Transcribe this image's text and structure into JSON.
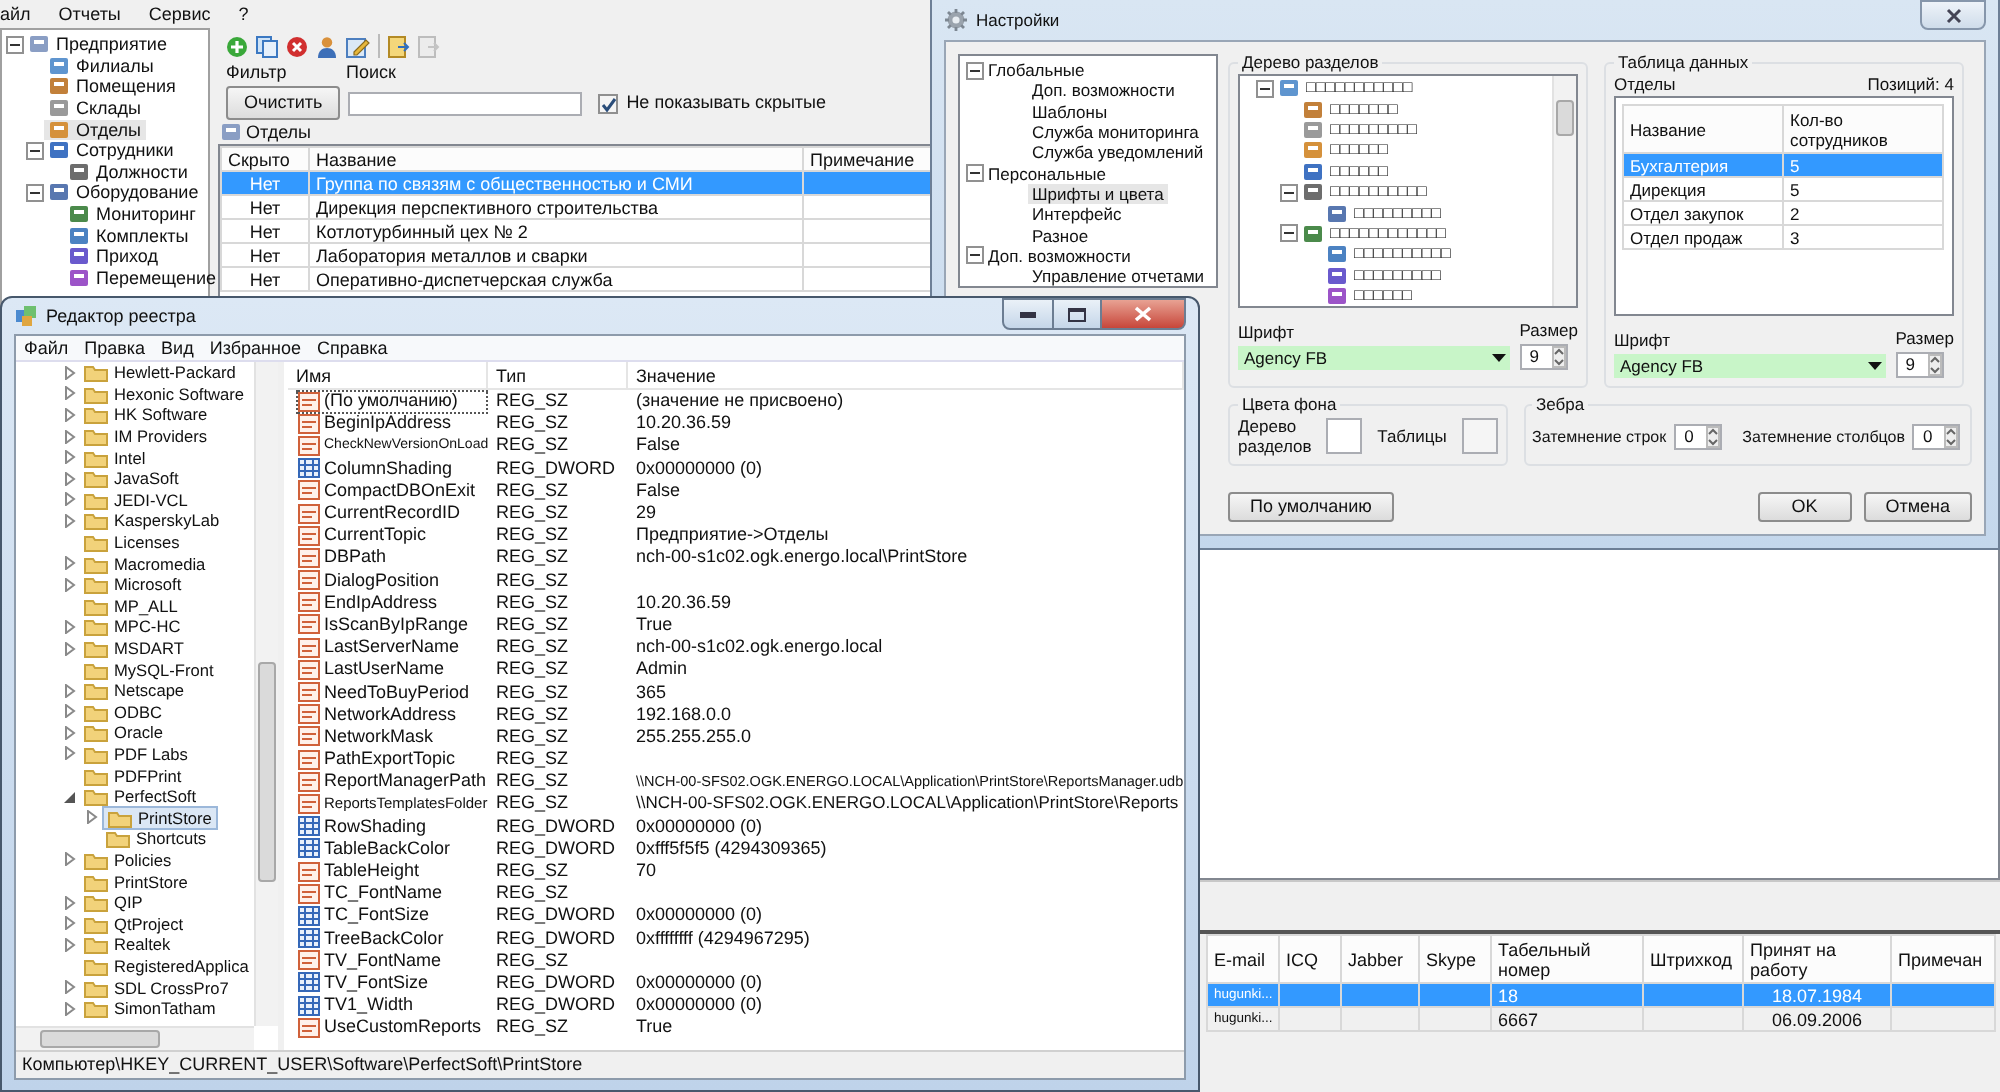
{
  "main_window": {
    "menu": [
      "айл",
      "Отчеты",
      "Сервис",
      "?"
    ],
    "tree": [
      {
        "label": "Предприятие",
        "selected": false,
        "children": [
          {
            "label": "Филиалы",
            "selected": false
          },
          {
            "label": "Помещения",
            "selected": false
          },
          {
            "label": "Склады",
            "selected": false
          },
          {
            "label": "Отделы",
            "selected": true
          },
          {
            "label": "Сотрудники",
            "selected": false,
            "children": [
              {
                "label": "Должности",
                "selected": false
              }
            ]
          },
          {
            "label": "Оборудование",
            "selected": false,
            "children": [
              {
                "label": "Мониторинг",
                "selected": false
              },
              {
                "label": "Комплекты",
                "selected": false
              },
              {
                "label": "Приход",
                "selected": false
              },
              {
                "label": "Перемещение",
                "selected": false
              }
            ]
          }
        ]
      }
    ],
    "filter": {
      "filter_label": "Фильтр",
      "clear_button": "Очистить",
      "search_label": "Поиск",
      "hide_hidden": {
        "label": "Не показывать скрытые",
        "checked": true
      }
    },
    "grid_title": "Отделы",
    "grid": {
      "columns": [
        "Скрыто",
        "Название",
        "Примечание"
      ],
      "rows": [
        {
          "hidden": "Нет",
          "name": "Группа по связям с общественностью и СМИ",
          "selected": true
        },
        {
          "hidden": "Нет",
          "name": "Дирекция перспективного строительства",
          "selected": false
        },
        {
          "hidden": "Нет",
          "name": "Котлотурбинный цех № 2",
          "selected": false
        },
        {
          "hidden": "Нет",
          "name": "Лаборатория металлов и сварки",
          "selected": false
        },
        {
          "hidden": "Нет",
          "name": "Оперативно-диспетчерская служба",
          "selected": false
        }
      ]
    },
    "employees": {
      "columns": [
        "E-mail",
        "ICQ",
        "Jabber",
        "Skype",
        "Табельный номер",
        "Штрихкод",
        "Принят на работу",
        "Примечан"
      ],
      "rows": [
        {
          "email": "hugunki...",
          "number": "18",
          "hired": "18.07.1984",
          "selected": true
        },
        {
          "email": "hugunki...",
          "number": "6667",
          "hired": "06.09.2006",
          "selected": false
        }
      ]
    }
  },
  "settings_dialog": {
    "title": "Настройки",
    "nav": [
      {
        "label": "Глобальные",
        "selected": false,
        "children": [
          {
            "label": "Доп. возможности",
            "selected": false
          },
          {
            "label": "Шаблоны",
            "selected": false
          },
          {
            "label": "Служба мониторинга",
            "selected": false
          },
          {
            "label": "Служба уведомлений",
            "selected": false
          }
        ]
      },
      {
        "label": "Персональные",
        "selected": false,
        "children": [
          {
            "label": "Шрифты и цвета",
            "selected": true
          },
          {
            "label": "Интерфейс",
            "selected": false
          },
          {
            "label": "Разное",
            "selected": false
          }
        ]
      },
      {
        "label": "Доп. возможности",
        "selected": false,
        "children": [
          {
            "label": "Управление отчетами",
            "selected": false
          }
        ]
      }
    ],
    "sections_tree": {
      "title": "Дерево разделов",
      "items": [
        {
          "label": "□□□□□□□□□□□",
          "children": [
            {
              "label": "□□□□□□□"
            },
            {
              "label": "□□□□□□□□□"
            },
            {
              "label": "□□□□□□"
            },
            {
              "label": "□□□□□□"
            },
            {
              "label": "□□□□□□□□□□",
              "children": [
                {
                  "label": "□□□□□□□□□"
                }
              ]
            },
            {
              "label": "□□□□□□□□□□□□",
              "children": [
                {
                  "label": "□□□□□□□□□□"
                },
                {
                  "label": "□□□□□□□□□"
                },
                {
                  "label": "□□□□□□"
                }
              ]
            }
          ]
        }
      ],
      "font": {
        "label": "Шрифт",
        "value": "Agency FB",
        "size_label": "Размер",
        "size": "9"
      }
    },
    "data_table": {
      "title": "Таблица данных",
      "caption": "Отделы",
      "count": "Позиций: 4",
      "columns": [
        "Название",
        "Кол-во сотрудников"
      ],
      "rows": [
        {
          "name": "Бухгалтерия",
          "count": "5",
          "selected": true
        },
        {
          "name": "Дирекция",
          "count": "5",
          "selected": false
        },
        {
          "name": "Отдел закупок",
          "count": "2",
          "selected": false
        },
        {
          "name": "Отдел продаж",
          "count": "3",
          "selected": false
        }
      ],
      "font": {
        "label": "Шрифт",
        "value": "Agency FB",
        "size_label": "Размер",
        "size": "9"
      }
    },
    "background": {
      "title": "Цвета фона",
      "swatches": [
        {
          "label": "Дерево разделов",
          "color": "#ffffff"
        },
        {
          "label": "Таблицы",
          "color": "#f5f5f5"
        }
      ]
    },
    "zebra": {
      "title": "Зебра",
      "spinners": [
        {
          "label": "Затемнение строк",
          "value": "0"
        },
        {
          "label": "Затемнение столбцов",
          "value": "0"
        }
      ]
    },
    "buttons": {
      "default": "По умолчанию",
      "ok": "OK",
      "cancel": "Отмена"
    }
  },
  "registry_editor": {
    "title": "Редактор реестра",
    "menu": [
      "Файл",
      "Правка",
      "Вид",
      "Избранное",
      "Справка"
    ],
    "tree": [
      {
        "label": "Hewlett-Packard",
        "kind": "closed",
        "selected": false
      },
      {
        "label": "Hexonic Software",
        "kind": "closed",
        "selected": false
      },
      {
        "label": "HK Software",
        "kind": "closed",
        "selected": false
      },
      {
        "label": "IM Providers",
        "kind": "closed",
        "selected": false
      },
      {
        "label": "Intel",
        "kind": "closed",
        "selected": false
      },
      {
        "label": "JavaSoft",
        "kind": "closed",
        "selected": false
      },
      {
        "label": "JEDI-VCL",
        "kind": "closed",
        "selected": false
      },
      {
        "label": "KasperskyLab",
        "kind": "closed",
        "selected": false
      },
      {
        "label": "Licenses",
        "kind": "leaf",
        "selected": false
      },
      {
        "label": "Macromedia",
        "kind": "closed",
        "selected": false
      },
      {
        "label": "Microsoft",
        "kind": "closed",
        "selected": false
      },
      {
        "label": "MP_ALL",
        "kind": "leaf",
        "selected": false
      },
      {
        "label": "MPC-HC",
        "kind": "closed",
        "selected": false
      },
      {
        "label": "MSDART",
        "kind": "closed",
        "selected": false
      },
      {
        "label": "MySQL-Front",
        "kind": "leaf",
        "selected": false
      },
      {
        "label": "Netscape",
        "kind": "closed",
        "selected": false
      },
      {
        "label": "ODBC",
        "kind": "closed",
        "selected": false
      },
      {
        "label": "Oracle",
        "kind": "closed",
        "selected": false
      },
      {
        "label": "PDF Labs",
        "kind": "closed",
        "selected": false
      },
      {
        "label": "PDFPrint",
        "kind": "leaf",
        "selected": false
      },
      {
        "label": "PerfectSoft",
        "kind": "open",
        "selected": false,
        "children": [
          {
            "label": "PrintStore",
            "kind": "closed",
            "selected": true
          },
          {
            "label": "Shortcuts",
            "kind": "leaf",
            "selected": false
          }
        ]
      },
      {
        "label": "Policies",
        "kind": "closed",
        "selected": false
      },
      {
        "label": "PrintStore",
        "kind": "leaf",
        "selected": false
      },
      {
        "label": "QIP",
        "kind": "closed",
        "selected": false
      },
      {
        "label": "QtProject",
        "kind": "closed",
        "selected": false
      },
      {
        "label": "Realtek",
        "kind": "closed",
        "selected": false
      },
      {
        "label": "RegisteredApplica",
        "kind": "leaf",
        "selected": false
      },
      {
        "label": "SDL CrossPro7",
        "kind": "closed",
        "selected": false
      },
      {
        "label": "SimonTatham",
        "kind": "closed",
        "selected": false
      }
    ],
    "columns": [
      "Имя",
      "Тип",
      "Значение"
    ],
    "values": [
      {
        "kind": "string",
        "name": "(По умолчанию)",
        "type": "REG_SZ",
        "data": "(значение не присвоено)",
        "selected": true
      },
      {
        "kind": "string",
        "name": "BeginIpAddress",
        "type": "REG_SZ",
        "data": "10.20.36.59",
        "selected": false
      },
      {
        "kind": "string",
        "name": "CheckNewVersionOnLoad",
        "type": "REG_SZ",
        "data": "False",
        "selected": false
      },
      {
        "kind": "dword",
        "name": "ColumnShading",
        "type": "REG_DWORD",
        "data": "0x00000000 (0)",
        "selected": false
      },
      {
        "kind": "string",
        "name": "CompactDBOnExit",
        "type": "REG_SZ",
        "data": "False",
        "selected": false
      },
      {
        "kind": "string",
        "name": "CurrentRecordID",
        "type": "REG_SZ",
        "data": "29",
        "selected": false
      },
      {
        "kind": "string",
        "name": "CurrentTopic",
        "type": "REG_SZ",
        "data": "Предприятие->Отделы",
        "selected": false
      },
      {
        "kind": "string",
        "name": "DBPath",
        "type": "REG_SZ",
        "data": "nch-00-s1c02.ogk.energo.local\\PrintStore",
        "selected": false
      },
      {
        "kind": "string",
        "name": "DialogPosition",
        "type": "REG_SZ",
        "selected": false
      },
      {
        "kind": "string",
        "name": "EndIpAddress",
        "type": "REG_SZ",
        "data": "10.20.36.59",
        "selected": false
      },
      {
        "kind": "string",
        "name": "IsScanByIpRange",
        "type": "REG_SZ",
        "data": "True",
        "selected": false
      },
      {
        "kind": "string",
        "name": "LastServerName",
        "type": "REG_SZ",
        "data": "nch-00-s1c02.ogk.energo.local",
        "selected": false
      },
      {
        "kind": "string",
        "name": "LastUserName",
        "type": "REG_SZ",
        "data": "Admin",
        "selected": false
      },
      {
        "kind": "string",
        "name": "NeedToBuyPeriod",
        "type": "REG_SZ",
        "data": "365",
        "selected": false
      },
      {
        "kind": "string",
        "name": "NetworkAddress",
        "type": "REG_SZ",
        "data": "192.168.0.0",
        "selected": false
      },
      {
        "kind": "string",
        "name": "NetworkMask",
        "type": "REG_SZ",
        "data": "255.255.255.0",
        "selected": false
      },
      {
        "kind": "string",
        "name": "PathExportTopic",
        "type": "REG_SZ",
        "selected": false
      },
      {
        "kind": "string",
        "name": "ReportManagerPath",
        "type": "REG_SZ",
        "data": "\\\\NCH-00-SFS02.OGK.ENERGO.LOCAL\\Application\\PrintStore\\ReportsManager.udb",
        "selected": false
      },
      {
        "kind": "string",
        "name": "ReportsTemplatesFolder",
        "type": "REG_SZ",
        "data": "\\\\NCH-00-SFS02.OGK.ENERGO.LOCAL\\Application\\PrintStore\\Reports",
        "selected": false
      },
      {
        "kind": "dword",
        "name": "RowShading",
        "type": "REG_DWORD",
        "data": "0x00000000 (0)",
        "selected": false
      },
      {
        "kind": "dword",
        "name": "TableBackColor",
        "type": "REG_DWORD",
        "data": "0xfff5f5f5 (4294309365)",
        "selected": false
      },
      {
        "kind": "string",
        "name": "TableHeight",
        "type": "REG_SZ",
        "data": "70",
        "selected": false
      },
      {
        "kind": "string",
        "name": "TC_FontName",
        "type": "REG_SZ",
        "selected": false
      },
      {
        "kind": "dword",
        "name": "TC_FontSize",
        "type": "REG_DWORD",
        "data": "0x00000000 (0)",
        "selected": false
      },
      {
        "kind": "dword",
        "name": "TreeBackColor",
        "type": "REG_DWORD",
        "data": "0xffffffff (4294967295)",
        "selected": false
      },
      {
        "kind": "string",
        "name": "TV_FontName",
        "type": "REG_SZ",
        "selected": false
      },
      {
        "kind": "dword",
        "name": "TV_FontSize",
        "type": "REG_DWORD",
        "data": "0x00000000 (0)",
        "selected": false
      },
      {
        "kind": "dword",
        "name": "TV1_Width",
        "type": "REG_DWORD",
        "data": "0x00000000 (0)",
        "selected": false
      },
      {
        "kind": "string",
        "name": "UseCustomReports",
        "type": "REG_SZ",
        "data": "True",
        "selected": false
      }
    ],
    "status": "Компьютер\\HKEY_CURRENT_USER\\Software\\PerfectSoft\\PrintStore"
  }
}
